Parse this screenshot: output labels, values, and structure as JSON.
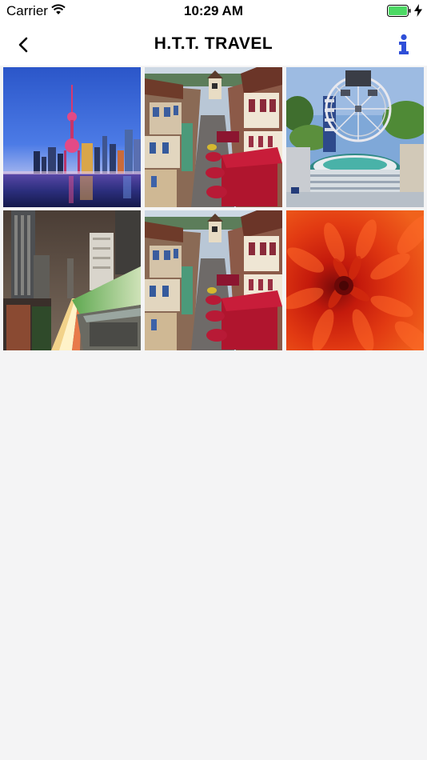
{
  "status_bar": {
    "carrier": "Carrier",
    "time": "10:29 AM",
    "icons": [
      "wifi-icon",
      "battery-icon",
      "charging-bolt-icon"
    ],
    "battery_color": "#4cd964"
  },
  "nav_bar": {
    "title": "H.T.T. TRAVEL",
    "left_icon": "chevron-left-icon",
    "right_icon": "info-icon",
    "accent_color": "#2f4fd8"
  },
  "gallery": {
    "photos": [
      {
        "subject": "city-skyline-night"
      },
      {
        "subject": "european-village-street"
      },
      {
        "subject": "ferris-wheel-miniature-park"
      },
      {
        "subject": "night-city-light-trails"
      },
      {
        "subject": "european-village-street"
      },
      {
        "subject": "red-chrysanthemum"
      }
    ]
  },
  "colors": {
    "background": "#f4f4f5",
    "bar_background": "#ffffff"
  }
}
